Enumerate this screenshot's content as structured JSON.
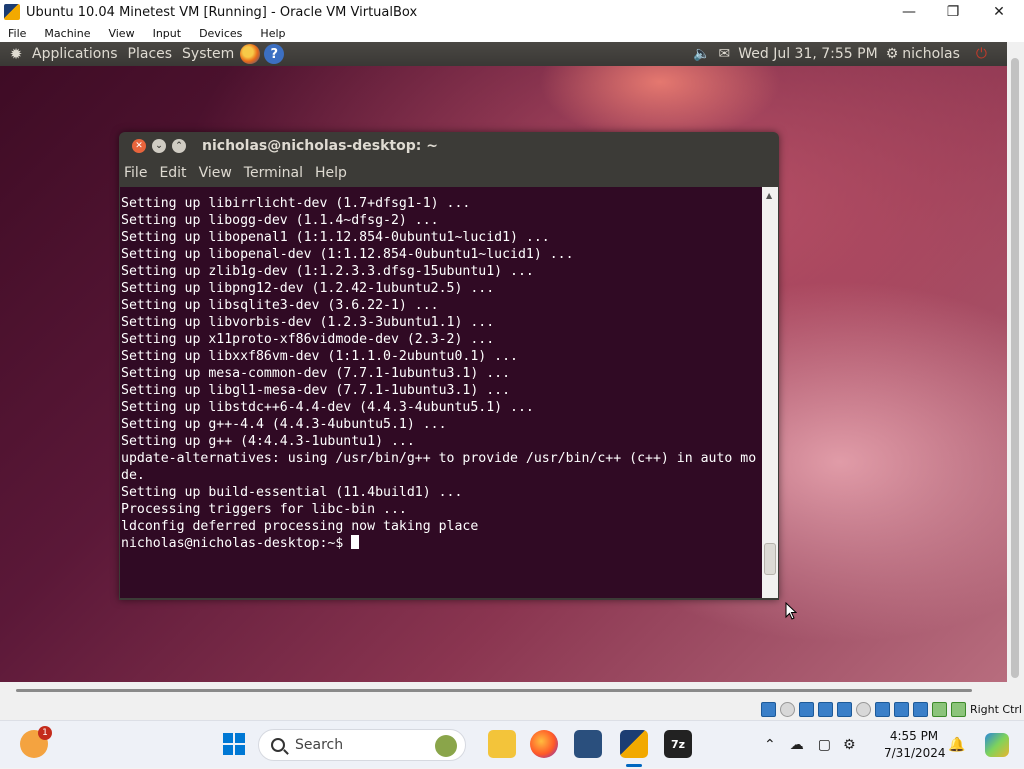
{
  "host_window": {
    "title": "Ubuntu 10.04 Minetest VM [Running] - Oracle VM VirtualBox",
    "menu": [
      "File",
      "Machine",
      "View",
      "Input",
      "Devices",
      "Help"
    ],
    "status_right_ctrl": "Right Ctrl"
  },
  "guest_panel": {
    "menus": [
      "Applications",
      "Places",
      "System"
    ],
    "datetime": "Wed Jul 31,  7:55 PM",
    "user": "nicholas"
  },
  "terminal": {
    "title": "nicholas@nicholas-desktop: ~",
    "menu": [
      "File",
      "Edit",
      "View",
      "Terminal",
      "Help"
    ],
    "lines": [
      "Setting up libirrlicht-dev (1.7+dfsg1-1) ...",
      "Setting up libogg-dev (1.1.4~dfsg-2) ...",
      "Setting up libopenal1 (1:1.12.854-0ubuntu1~lucid1) ...",
      "",
      "Setting up libopenal-dev (1:1.12.854-0ubuntu1~lucid1) ...",
      "Setting up zlib1g-dev (1:1.2.3.3.dfsg-15ubuntu1) ...",
      "Setting up libpng12-dev (1.2.42-1ubuntu2.5) ...",
      "Setting up libsqlite3-dev (3.6.22-1) ...",
      "Setting up libvorbis-dev (1.2.3-3ubuntu1.1) ...",
      "Setting up x11proto-xf86vidmode-dev (2.3-2) ...",
      "Setting up libxxf86vm-dev (1:1.1.0-2ubuntu0.1) ...",
      "Setting up mesa-common-dev (7.7.1-1ubuntu3.1) ...",
      "Setting up libgl1-mesa-dev (7.7.1-1ubuntu3.1) ...",
      "Setting up libstdc++6-4.4-dev (4.4.3-4ubuntu5.1) ...",
      "Setting up g++-4.4 (4.4.3-4ubuntu5.1) ...",
      "Setting up g++ (4:4.4.3-1ubuntu1) ...",
      "update-alternatives: using /usr/bin/g++ to provide /usr/bin/c++ (c++) in auto mo",
      "de.",
      "",
      "Setting up build-essential (11.4build1) ...",
      "Processing triggers for libc-bin ...",
      "ldconfig deferred processing now taking place"
    ],
    "prompt": "nicholas@nicholas-desktop:~$ "
  },
  "taskbar": {
    "search_placeholder": "Search",
    "notification_badge": "1",
    "time": "4:55 PM",
    "date": "7/31/2024"
  },
  "icons": {
    "guest_panel": [
      "ubuntu-logo-icon",
      "firefox-icon",
      "help-icon",
      "volume-icon",
      "mail-icon",
      "user-status-icon",
      "power-icon"
    ],
    "taskbar": [
      "widgets-icon",
      "start-icon",
      "search-icon",
      "file-explorer-icon",
      "firefox-icon",
      "virtualbox-icon",
      "virtualbox-vm-icon",
      "7zip-icon"
    ],
    "tray": [
      "chevron-up-icon",
      "network-off-icon",
      "display-icon",
      "settings-icon",
      "notification-bell-icon",
      "copilot-icon"
    ]
  },
  "colors": {
    "terminal_bg": "#300a24",
    "panel_bg": "#3c3b37",
    "close_button": "#e8643c",
    "windows_accent": "#0067c0"
  }
}
